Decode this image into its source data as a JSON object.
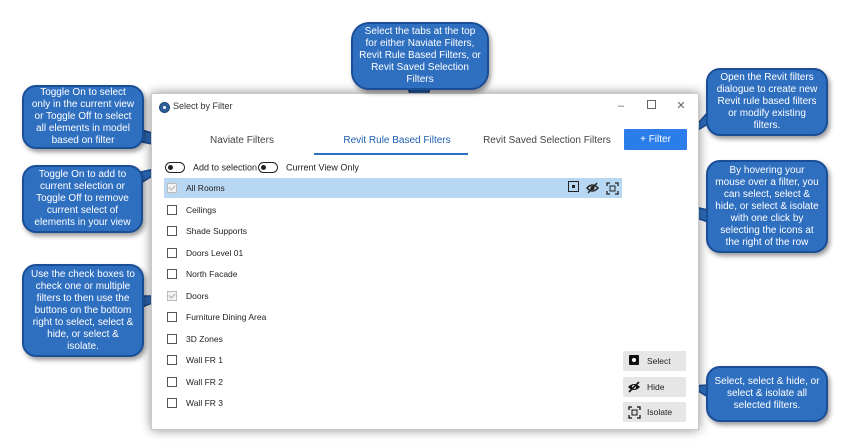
{
  "window": {
    "title": "Select by Filter",
    "minimize_glyph": "–",
    "close_glyph": "✕"
  },
  "tabs": [
    {
      "label": "Naviate Filters",
      "active": false
    },
    {
      "label": "Revit Rule Based Filters",
      "active": true
    },
    {
      "label": "Revit Saved Selection Filters",
      "active": false
    }
  ],
  "filter_button": {
    "label": "+  Filter"
  },
  "toggles": {
    "add_to_selection": "Add to selection",
    "current_view_only": "Current View Only"
  },
  "rows": [
    {
      "label": "All Rooms",
      "checked": true,
      "highlighted": true
    },
    {
      "label": "Ceilings",
      "checked": false
    },
    {
      "label": "Shade Supports",
      "checked": false
    },
    {
      "label": "Doors Level 01",
      "checked": false
    },
    {
      "label": "North Facade",
      "checked": false
    },
    {
      "label": "Doors",
      "checked": true
    },
    {
      "label": "Furniture Dining Area",
      "checked": false
    },
    {
      "label": "3D Zones",
      "checked": false
    },
    {
      "label": "Wall FR 1",
      "checked": false
    },
    {
      "label": "Wall FR 2",
      "checked": false
    },
    {
      "label": "Wall FR 3",
      "checked": false
    }
  ],
  "row_icons": [
    "select-icon",
    "hide-icon",
    "isolate-icon"
  ],
  "side_buttons": {
    "select": "Select",
    "hide": "Hide",
    "isolate": "Isolate"
  },
  "callouts": {
    "tabs": "Select the tabs at the top for either Naviate Filters, Revit Rule Based Filters, or Revit Saved Selection Filters",
    "toggle_view": "Toggle On to select only in the current view or Toggle Off to select all elements in model based on filter",
    "toggle_add": "Toggle On to add to current selection or Toggle Off to remove current select of elements in your view",
    "checkboxes": "Use the check boxes to check one or multiple filters to then use the buttons on the bottom right to select, select & hide, or select & isolate.",
    "filter_dialog": "Open the Revit filters dialogue to create new Revit rule based filters or modify existing filters.",
    "hover": "By hovering your mouse over a filter, you can select, select & hide, or select & isolate with one click by selecting the icons at the right of the row",
    "select_all": "Select, select & hide, or select & isolate all selected filters."
  },
  "colors": {
    "accent": "#2b7de9",
    "callout": "#2f6fc0",
    "row_highlight": "#b8d7f3"
  }
}
